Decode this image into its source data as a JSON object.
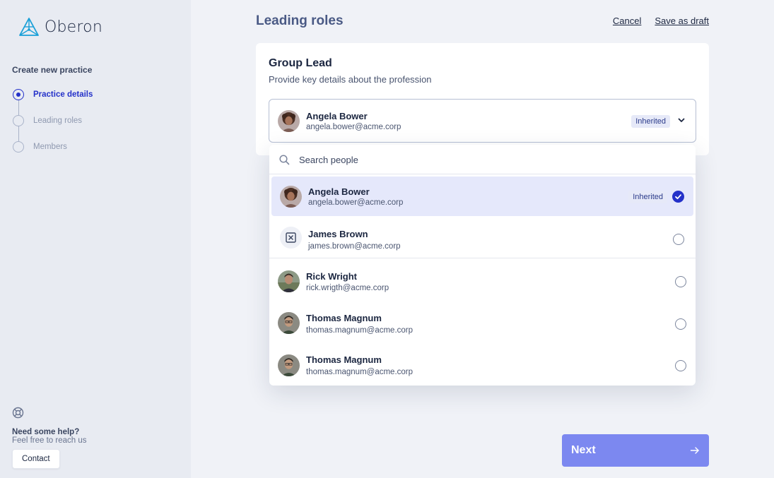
{
  "brand": {
    "name": "Oberon",
    "accent": "#2431c9",
    "logo_color": "#1aa0d8"
  },
  "sidebar": {
    "heading": "Create new practice",
    "steps": [
      {
        "label": "Practice details",
        "state": "active"
      },
      {
        "label": "Leading roles",
        "state": "upcoming"
      },
      {
        "label": "Members",
        "state": "upcoming"
      }
    ],
    "help": {
      "icon": "lifebuoy-icon",
      "title": "Need some help?",
      "subtitle": "Feel free to reach us",
      "contact_label": "Contact"
    }
  },
  "header": {
    "title": "Leading roles",
    "cancel_label": "Cancel",
    "save_draft_label": "Save as draft"
  },
  "card": {
    "title": "Group Lead",
    "subtitle": "Provide key details about the profession",
    "selected": {
      "name": "Angela Bower",
      "email": "angela.bower@acme.corp",
      "badge": "Inherited"
    }
  },
  "dropdown": {
    "search_placeholder": "Search people",
    "people": [
      {
        "name": "Angela Bower",
        "email": "angela.bower@acme.corp",
        "badge": "Inherited",
        "selected": true,
        "avatar": "photo"
      },
      {
        "name": "James Brown",
        "email": "james.brown@acme.corp",
        "selected": false,
        "avatar": "placeholder-icon"
      },
      {
        "name": "Rick Wright",
        "email": "rick.wrigth@acme.corp",
        "selected": false,
        "avatar": "photo"
      },
      {
        "name": "Thomas Magnum",
        "email": "thomas.magnum@acme.corp",
        "selected": false,
        "avatar": "photo"
      },
      {
        "name": "Thomas Magnum",
        "email": "thomas.magnum@acme.corp",
        "selected": false,
        "avatar": "photo"
      }
    ]
  },
  "footer": {
    "next_label": "Next"
  }
}
